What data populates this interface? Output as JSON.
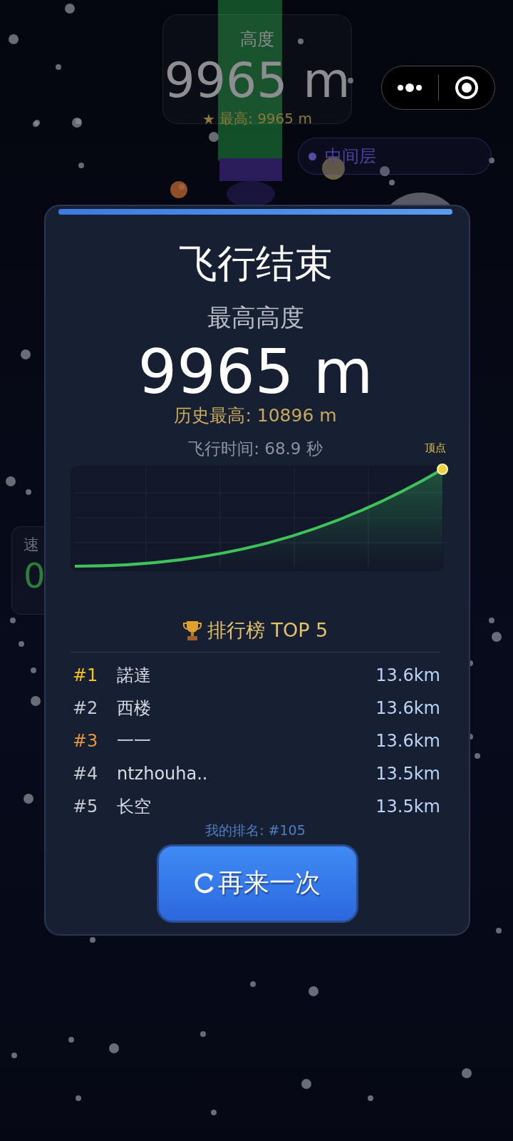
{
  "hud": {
    "altitude_label": "高度",
    "altitude": "9965 m",
    "best_icon": "★",
    "best": "最高: 9965 m",
    "layer": "中间层",
    "speed_label": "速",
    "speed": "0"
  },
  "result": {
    "title": "飞行结束",
    "peak_label": "最高高度",
    "peak": "9965 m",
    "record": "历史最高: 10896 m",
    "flight_time": "飞行时间: 68.9 秒",
    "chart_label": "顶点"
  },
  "leaderboard": {
    "title": "排行榜 TOP 5",
    "rows": [
      {
        "rank": "#1",
        "name": "諾達",
        "distance": "13.6km",
        "color": "#f5c518"
      },
      {
        "rank": "#2",
        "name": "西楼",
        "distance": "13.6km",
        "color": "#c8cad2"
      },
      {
        "rank": "#3",
        "name": "一一",
        "distance": "13.6km",
        "color": "#e8963a"
      },
      {
        "rank": "#4",
        "name": "ntzhouha..",
        "distance": "13.5km",
        "color": "#c8cad2"
      },
      {
        "rank": "#5",
        "name": "长空",
        "distance": "13.5km",
        "color": "#c8cad2"
      }
    ],
    "my_rank": "我的排名: #105"
  },
  "retry_button": "再来一次"
}
